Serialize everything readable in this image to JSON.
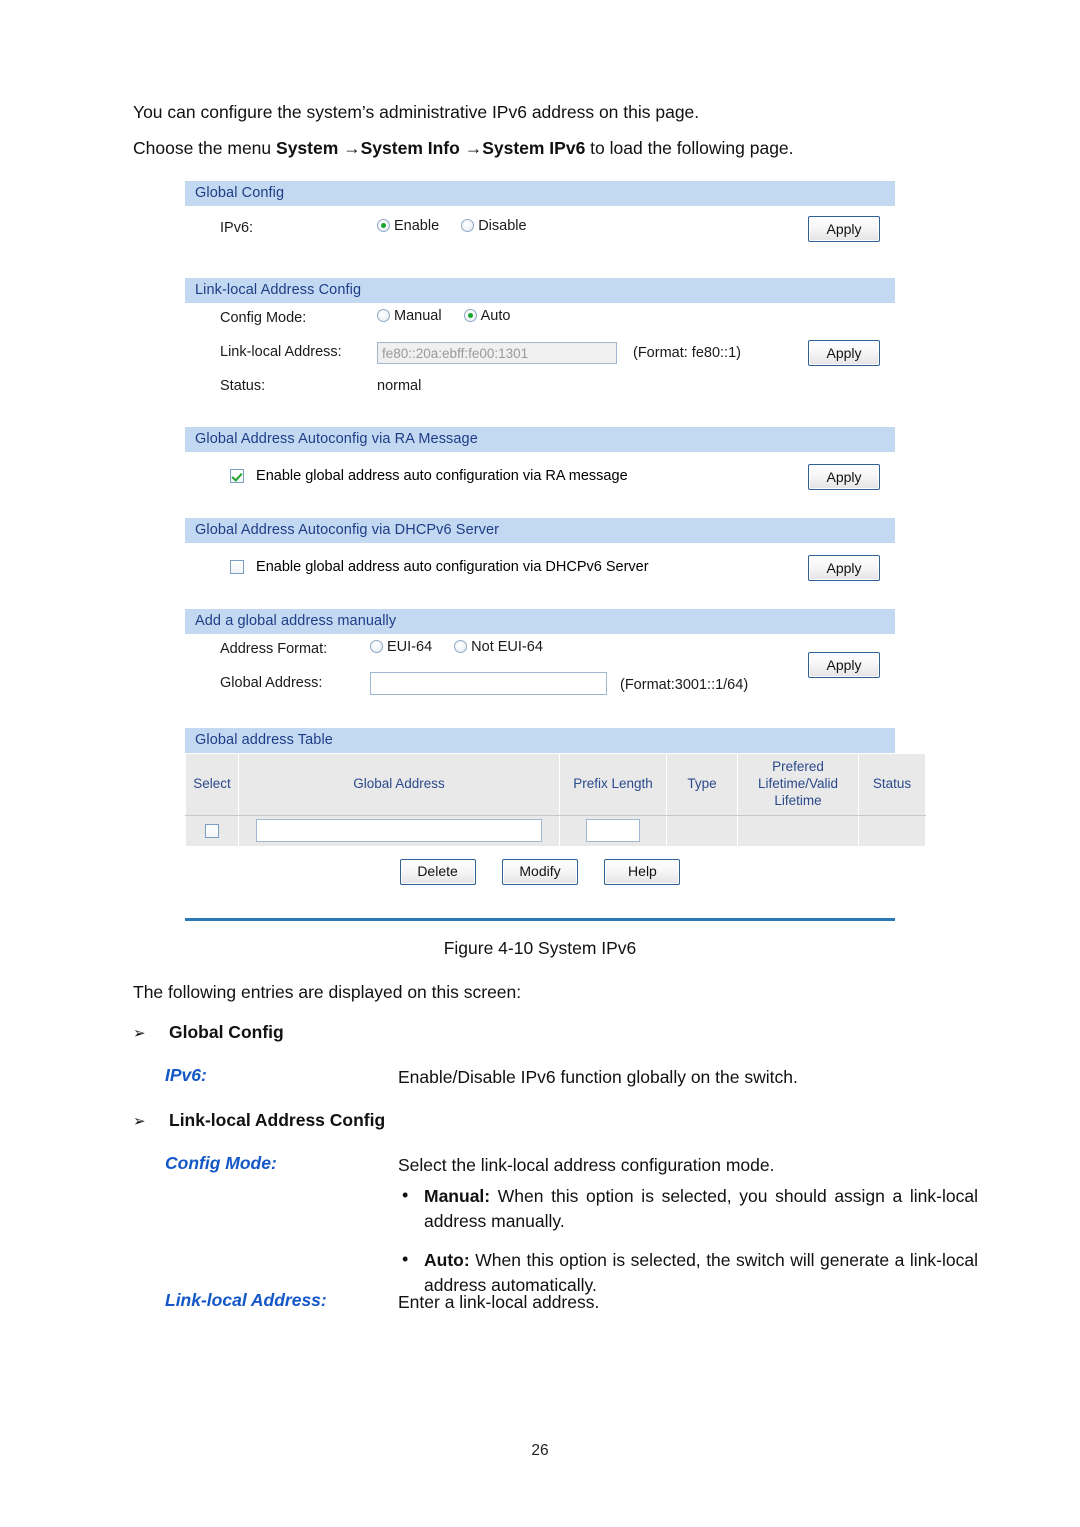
{
  "intro": {
    "line1": "You can configure the system’s administrative IPv6 address on this page.",
    "line2_prefix": "Choose the menu ",
    "menu_path": "System →System Info →System IPv6",
    "line2_suffix": " to load the following page."
  },
  "screenshot": {
    "global_config": {
      "section_title": "Global Config",
      "ipv6_label": "IPv6:",
      "options": [
        "Enable",
        "Disable"
      ],
      "selected": "Enable",
      "apply_label": "Apply"
    },
    "link_local": {
      "section_title": "Link-local Address Config",
      "config_mode_label": "Config Mode:",
      "config_mode_options": [
        "Manual",
        "Auto"
      ],
      "config_mode_selected": "Auto",
      "address_label": "Link-local Address:",
      "address_value": "fe80::20a:ebff:fe00:1301",
      "address_format_hint": "(Format: fe80::1)",
      "status_label": "Status:",
      "status_value": "normal",
      "apply_label": "Apply"
    },
    "ra_message": {
      "section_title": "Global Address Autoconfig via RA Message",
      "checkbox_label": "Enable global address auto configuration via RA message",
      "checked": true,
      "apply_label": "Apply"
    },
    "dhcpv6": {
      "section_title": "Global Address Autoconfig via DHCPv6 Server",
      "checkbox_label": "Enable global address auto configuration via DHCPv6 Server",
      "checked": false,
      "apply_label": "Apply"
    },
    "add_manual": {
      "section_title": "Add a global address manually",
      "address_format_label": "Address Format:",
      "format_options": [
        "EUI-64",
        "Not EUI-64"
      ],
      "format_selected": "",
      "global_address_label": "Global Address:",
      "global_address_value": "",
      "global_address_hint": "(Format:3001::1/64)",
      "apply_label": "Apply"
    },
    "global_table": {
      "section_title": "Global address Table",
      "columns": [
        "Select",
        "Global Address",
        "Prefix Length",
        "Type",
        "Prefered Lifetime/Valid Lifetime",
        "Status"
      ],
      "rows": [
        {
          "select": false,
          "global_address": "",
          "prefix_length": "",
          "type": "",
          "lifetime": "",
          "status": ""
        }
      ],
      "buttons": [
        "Delete",
        "Modify",
        "Help"
      ]
    },
    "colors": {
      "section_header_bg": "#c3d9f2",
      "section_header_text": "#1f3d87",
      "divider": "#2b78b4",
      "radio_dot": "#15a52a",
      "check_mark": "#21a32b",
      "table_header_bg": "#e9e9e9",
      "table_header_text": "#2a4a8c"
    }
  },
  "figure_caption": "Figure 4-10 System IPv6",
  "lead_in": "The following entries are displayed on this screen:",
  "sections": [
    {
      "heading": "Global Config",
      "arrow": "➢",
      "entries": [
        {
          "term": "IPv6:",
          "definition": "Enable/Disable IPv6 function globally on the switch."
        }
      ]
    },
    {
      "heading": "Link-local Address Config",
      "arrow": "➢",
      "entries": [
        {
          "term": "Config Mode:",
          "definition": "Select the link-local address configuration mode.",
          "bullets": [
            {
              "label": "Manual:",
              "text": " When this option is selected, you should assign a link-local address manually."
            },
            {
              "label": "Auto:",
              "text": " When this option is selected, the switch will generate a link-local address automatically."
            }
          ]
        },
        {
          "term": "Link-local Address:",
          "definition": "Enter a link-local address."
        }
      ]
    }
  ],
  "page_number": "26"
}
